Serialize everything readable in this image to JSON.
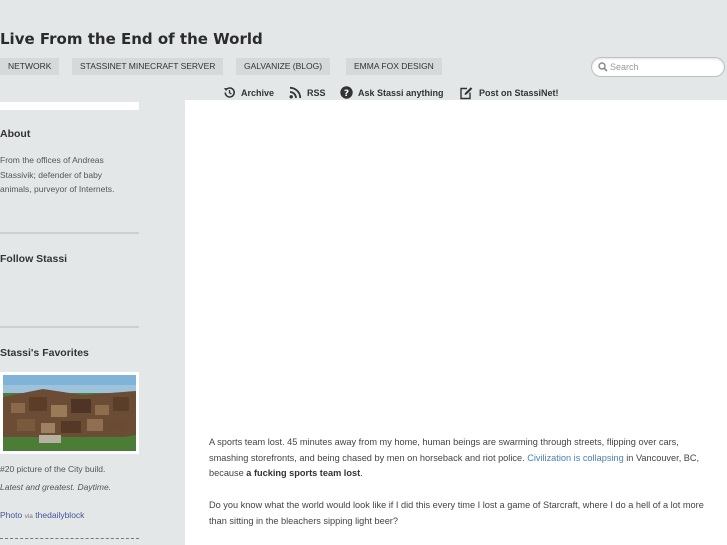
{
  "site": {
    "title": "Live From the End of the World"
  },
  "topnav": [
    {
      "label": "NETWORK"
    },
    {
      "label": "STASSINET MINECRAFT SERVER"
    },
    {
      "label": "GALVANIZE (BLOG)"
    },
    {
      "label": "EMMA FOX DESIGN"
    }
  ],
  "search": {
    "placeholder": "Search",
    "value": ""
  },
  "subnav": {
    "archive": "Archive",
    "rss": "RSS",
    "ask": "Ask Stassi anything",
    "post": "Post on StassiNet!"
  },
  "sidebar": {
    "about_title": "About",
    "about_text": "From the offices of Andreas Stassivik; defender of baby animals, purveyor of Internets.",
    "follow_title": "Follow Stassi",
    "favorites_title": "Stassi's Favorites",
    "fav_caption": "#20 picture of the City build.",
    "fav_subcaption": "Latest and greatest. Daytime.",
    "photo_label": "Photo",
    "via_label": "via",
    "via_source": "thedailyblock"
  },
  "post": {
    "p1_a": "A sports team lost. 45 minutes away from my home, human beings are swarming through streets, flipping over cars, smashing storefronts, and being chased by men on horseback and riot police. ",
    "p1_link": "Civilization is collapsing",
    "p1_b": " in Vancouver, BC, because ",
    "p1_bold": "a fucking sports team lost",
    "p1_c": ".",
    "p2": "Do you know what the world would look like if I did this every time I lost a game of Starcraft, where I do a hell of a lot more than sitting in the bleachers sipping light beer?"
  },
  "colors": {
    "background": "#e4e7e8",
    "link": "#4a7fb5",
    "nav_bg": "#d5d9da"
  },
  "icons": {
    "archive": "clock-history-icon",
    "rss": "rss-icon",
    "ask": "question-circle-icon",
    "post": "edit-icon",
    "search": "search-icon"
  }
}
